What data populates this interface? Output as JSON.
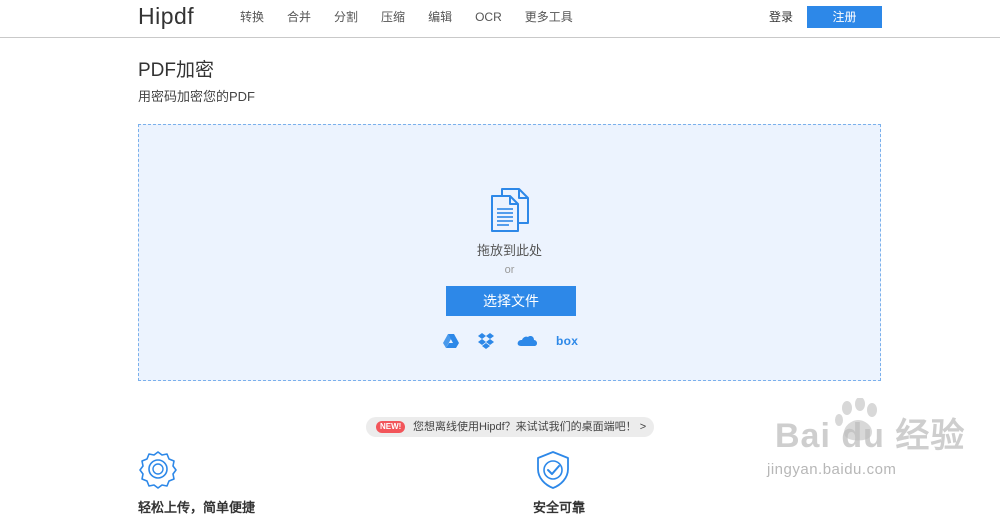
{
  "header": {
    "logo": "Hipdf",
    "nav": [
      "转换",
      "合并",
      "分割",
      "压缩",
      "编辑",
      "OCR",
      "更多工具"
    ],
    "login_label": "登录",
    "signup_label": "注册"
  },
  "main": {
    "title": "PDF加密",
    "subtitle": "用密码加密您的PDF"
  },
  "dropzone": {
    "drop_text": "拖放到此处",
    "or_text": "or",
    "choose_label": "选择文件",
    "cloud_sources": [
      "google-drive-icon",
      "dropbox-icon",
      "onedrive-icon",
      "box-icon"
    ],
    "box_label": "box"
  },
  "promo": {
    "badge": "NEW!",
    "text": "您想离线使用Hipdf？来试试我们的桌面端吧！ >"
  },
  "features": [
    {
      "icon": "award-ribbon-icon",
      "label": "轻松上传，简单便捷"
    },
    {
      "icon": "shield-check-icon",
      "label": "安全可靠"
    }
  ],
  "watermark": {
    "brand": "Bai du 经验",
    "url": "jingyan.baidu.com"
  },
  "colors": {
    "accent": "#2d88e8",
    "dropzone_bg": "#ecf3fe",
    "new_badge": "#f2555a"
  }
}
